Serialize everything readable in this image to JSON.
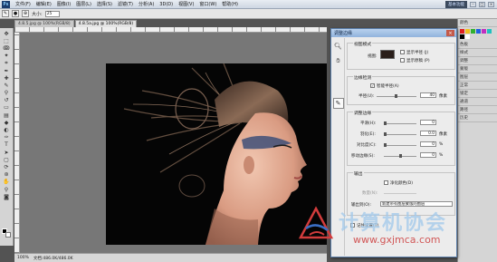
{
  "menubar": {
    "logo": "Ps",
    "items": [
      "文件(F)",
      "编辑(E)",
      "图像(I)",
      "图层(L)",
      "选择(S)",
      "滤镜(T)",
      "分析(A)",
      "3D(D)",
      "视图(V)",
      "窗口(W)",
      "帮助(H)"
    ],
    "workspace": "基本功能"
  },
  "optbar": {
    "size_label": "大小:",
    "size_value": "25"
  },
  "tabs": [
    {
      "label": "4.8.5.jpg @ 100%(RGB/8)",
      "active": false
    },
    {
      "label": "4.8.5a.jpg @ 100%(RGB/8)",
      "active": true
    }
  ],
  "statusbar": {
    "zoom": "100%",
    "doc": "文档:486.0K/486.0K"
  },
  "dialog": {
    "title": "调整边缘",
    "view_mode": {
      "title": "视图模式",
      "view_label": "视图:",
      "show_radius": "显示半径 (J)",
      "show_original": "显示原稿 (P)"
    },
    "edge_detection": {
      "title": "边缘检测",
      "smart_radius": "智能半径(A)",
      "radius_label": "半径(U):",
      "radius_value": "40",
      "radius_unit": "像素"
    },
    "adjust_edge": {
      "title": "调整边缘",
      "rows": [
        {
          "label": "平滑(H):",
          "value": "0",
          "unit": ""
        },
        {
          "label": "羽化(E):",
          "value": "0.0",
          "unit": "像素"
        },
        {
          "label": "对比度(C):",
          "value": "0",
          "unit": "%"
        },
        {
          "label": "移动边缘(S):",
          "value": "0",
          "unit": "%"
        }
      ]
    },
    "output": {
      "title": "输出",
      "purify": "净化颜色(D)",
      "amount_label": "数量(N):",
      "output_to_label": "输出到(O):",
      "output_to_value": "新建带有图层蒙版的图层"
    },
    "remember": "记住设置(T)"
  },
  "right_panels": {
    "rows": [
      "颜色",
      "色板",
      "样式",
      "调整",
      "蒙版",
      "图层",
      "正常",
      "锁定",
      "通道",
      "路径",
      "历史"
    ],
    "swatch_colors": [
      "#e02020",
      "#f0c020",
      "#30b030",
      "#2060e0",
      "#c030c0",
      "#20c0c0",
      "#000000",
      "#ffffff"
    ]
  },
  "watermark": {
    "text": "计算机协会",
    "url": "www.gxjmca.com"
  },
  "colors": {
    "dialog_title": "#92b3dc",
    "canvas_bg": "#777777",
    "photo_bg": "#050505"
  }
}
